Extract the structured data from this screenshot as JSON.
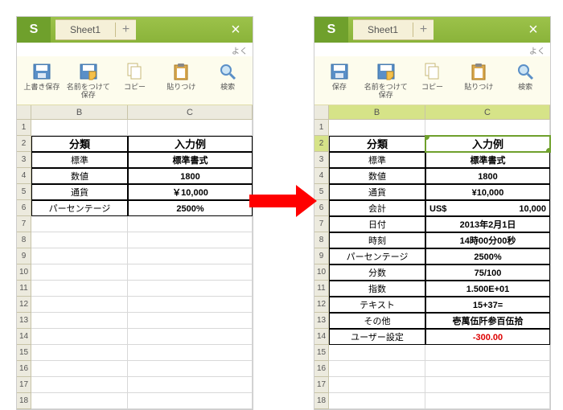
{
  "left": {
    "sheet_tab": "Sheet1",
    "hint": "よく",
    "toolbar": [
      "上書き保存",
      "名前をつけて\n保存",
      "コピー",
      "貼りつけ",
      "検索"
    ],
    "col_b": "B",
    "col_c": "C",
    "rows": [
      "1",
      "2",
      "3",
      "4",
      "5",
      "6",
      "7",
      "8",
      "9",
      "10",
      "11",
      "12",
      "13",
      "14",
      "15",
      "16",
      "17",
      "18"
    ],
    "table": {
      "head": [
        "分類",
        "入力例"
      ],
      "rows": [
        [
          "標準",
          "標準書式"
        ],
        [
          "数値",
          "1800"
        ],
        [
          "通貨",
          "￥10,000"
        ],
        [
          "パーセンテージ",
          "2500%"
        ]
      ]
    }
  },
  "right": {
    "sheet_tab": "Sheet1",
    "hint": "よく",
    "toolbar": [
      "保存",
      "名前をつけて\n保存",
      "コピー",
      "貼りつけ",
      "検索"
    ],
    "col_b": "B",
    "col_c": "C",
    "rows": [
      "1",
      "2",
      "3",
      "4",
      "5",
      "6",
      "7",
      "8",
      "9",
      "10",
      "11",
      "12",
      "13",
      "14",
      "15",
      "16",
      "17",
      "18"
    ],
    "table": {
      "head": [
        "分類",
        "入力例"
      ],
      "rows": [
        [
          "標準",
          "標準書式"
        ],
        [
          "数値",
          "1800"
        ],
        [
          "通貨",
          "¥10,000"
        ],
        [
          "会計",
          {
            "left": "US$",
            "right": "10,000"
          }
        ],
        [
          "日付",
          "2013年2月1日"
        ],
        [
          "時刻",
          "14時00分00秒"
        ],
        [
          "パーセンテージ",
          "2500%"
        ],
        [
          "分数",
          "75/100"
        ],
        [
          "指数",
          "1.500E+01"
        ],
        [
          "テキスト",
          "15+37="
        ],
        [
          "その他",
          "壱萬伍阡参百伍拾"
        ],
        [
          "ユーザー設定",
          {
            "text": "-300.00",
            "red": true
          }
        ]
      ]
    }
  }
}
